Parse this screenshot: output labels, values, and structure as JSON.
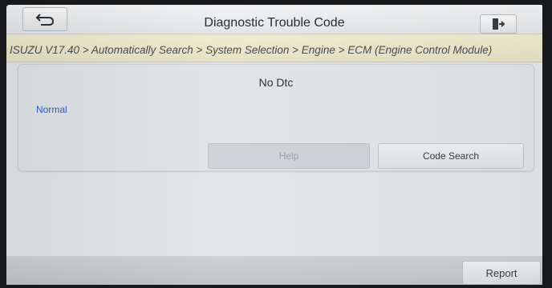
{
  "header": {
    "title": "Diagnostic Trouble Code",
    "back_icon": "back-arrow-icon",
    "exit_icon": "exit-icon"
  },
  "breadcrumb": {
    "path": "ISUZU V17.40 > Automatically Search > System Selection > Engine > ECM (Engine Control Module)"
  },
  "result": {
    "heading": "No Dtc",
    "status": "Normal",
    "status_color": "#2e5fcf"
  },
  "actions": {
    "help_label": "Help",
    "code_search_label": "Code Search"
  },
  "footer": {
    "report_label": "Report"
  }
}
